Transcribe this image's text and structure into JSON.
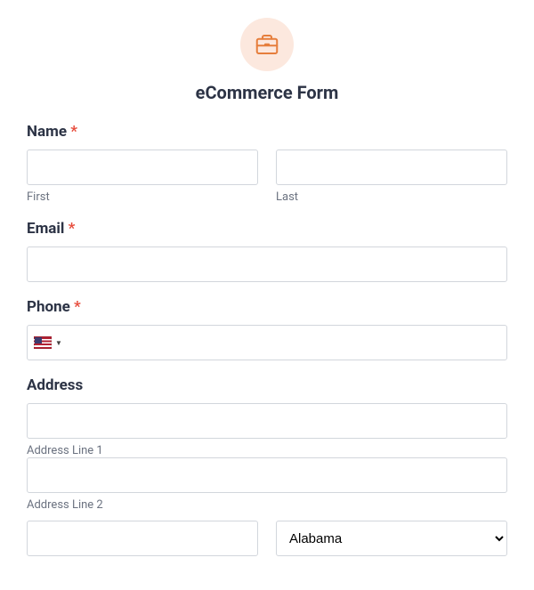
{
  "form": {
    "title": "eCommerce Form",
    "icon": "briefcase-icon",
    "fields": {
      "name": {
        "label": "Name",
        "required_mark": "*",
        "first_sublabel": "First",
        "last_sublabel": "Last",
        "first_value": "",
        "last_value": ""
      },
      "email": {
        "label": "Email",
        "required_mark": "*",
        "value": ""
      },
      "phone": {
        "label": "Phone",
        "required_mark": "*",
        "country": "US",
        "value": ""
      },
      "address": {
        "label": "Address",
        "line1_value": "",
        "line1_sublabel": "Address Line 1",
        "line2_value": "",
        "line2_sublabel": "Address Line 2",
        "city_value": "",
        "state_selected": "Alabama"
      }
    }
  }
}
